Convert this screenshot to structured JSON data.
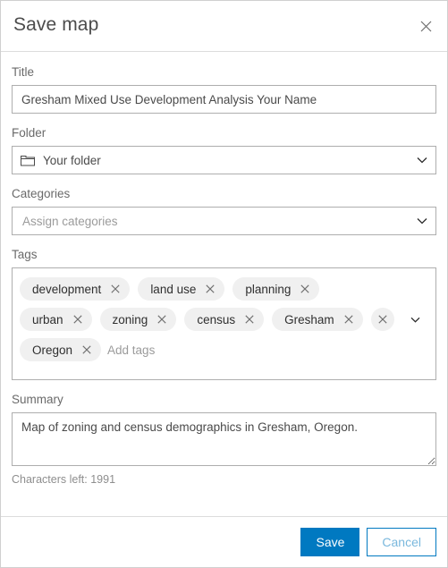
{
  "dialog": {
    "title": "Save map",
    "close_icon": "close-icon"
  },
  "fields": {
    "title": {
      "label": "Title",
      "value": "Gresham Mixed Use Development Analysis Your Name",
      "placeholder": "Title"
    },
    "folder": {
      "label": "Folder",
      "value": "Your folder",
      "icon": "folder-icon",
      "chevron": "chevron-down-icon"
    },
    "categories": {
      "label": "Categories",
      "placeholder": "Assign categories",
      "value": "Assign categories",
      "chevron": "chevron-down-icon"
    },
    "tags": {
      "label": "Tags",
      "add_placeholder": "Add tags",
      "rows": [
        [
          "development",
          "land use",
          "planning"
        ],
        [
          "urban",
          "zoning",
          "census",
          "Gresham"
        ],
        [
          "Oregon"
        ]
      ],
      "clear_all_icon": "close-circle-icon",
      "chevron": "chevron-down-icon"
    },
    "summary": {
      "label": "Summary",
      "value": "Map of zoning and census demographics in Gresham, Oregon.",
      "placeholder": "Summary",
      "characters_left": "Characters left: 1991"
    }
  },
  "footer": {
    "save_label": "Save",
    "cancel_label": "Cancel"
  },
  "colors": {
    "accent": "#0079c1",
    "cancel_text": "#7ab8dd",
    "chip_bg": "#f0f0f0",
    "border": "#aeaeae",
    "divider": "#dcdcdc"
  }
}
